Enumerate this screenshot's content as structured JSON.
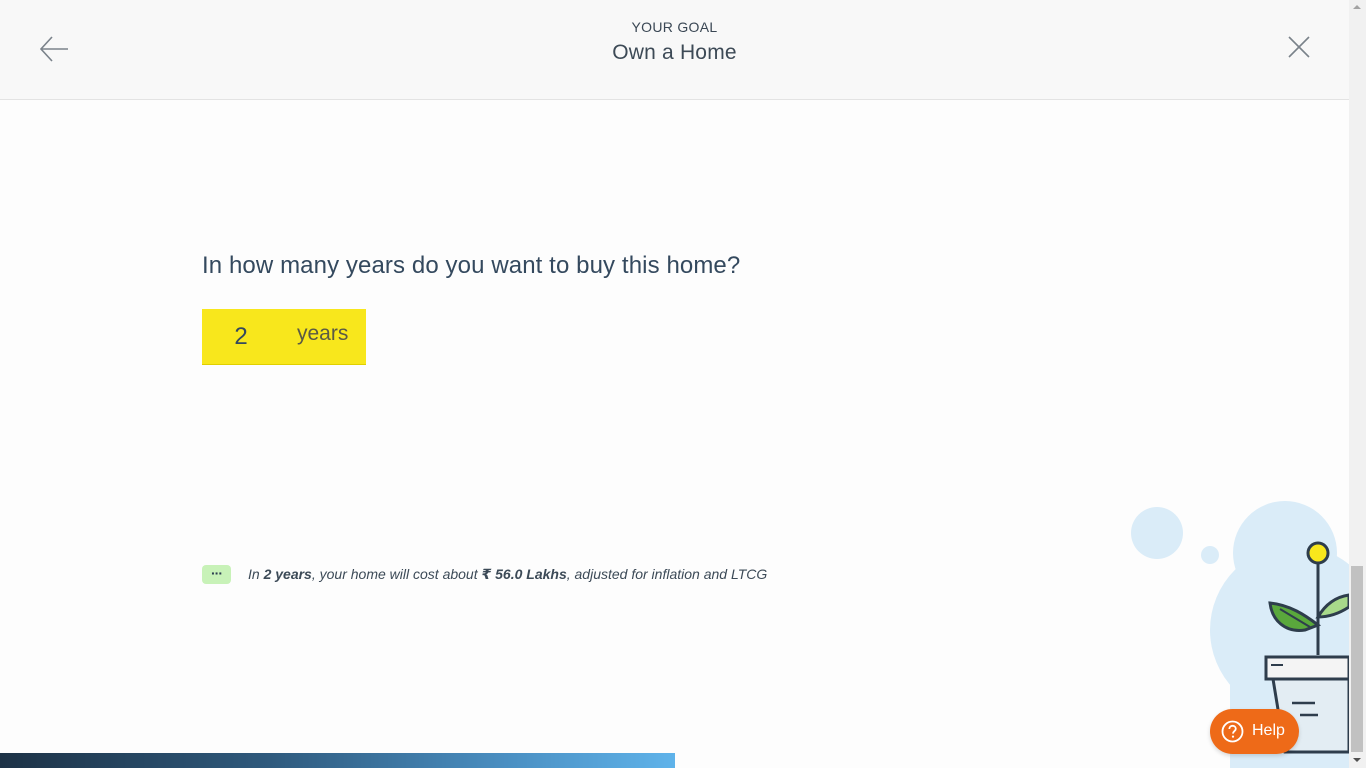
{
  "header": {
    "kicker": "YOUR GOAL",
    "title": "Own a Home",
    "back_icon": "arrow-left-icon",
    "close_icon": "close-icon"
  },
  "question": {
    "text": "In how many years do you want to buy this home?",
    "value": "2",
    "unit": "years"
  },
  "info": {
    "icon": "chat-bubble-icon",
    "prefix": "In ",
    "years": "2 years",
    "middle": ", your home will cost about ",
    "amount": "₹ 56.0 Lakhs",
    "suffix": ", adjusted for inflation and LTCG"
  },
  "help": {
    "label": "Help",
    "icon": "question-circle-icon"
  },
  "progress": {
    "fraction": 0.494
  },
  "colors": {
    "input_bg": "#f8e71c",
    "help_bg": "#ee6a18",
    "chat_bg": "#c8f2b8"
  }
}
